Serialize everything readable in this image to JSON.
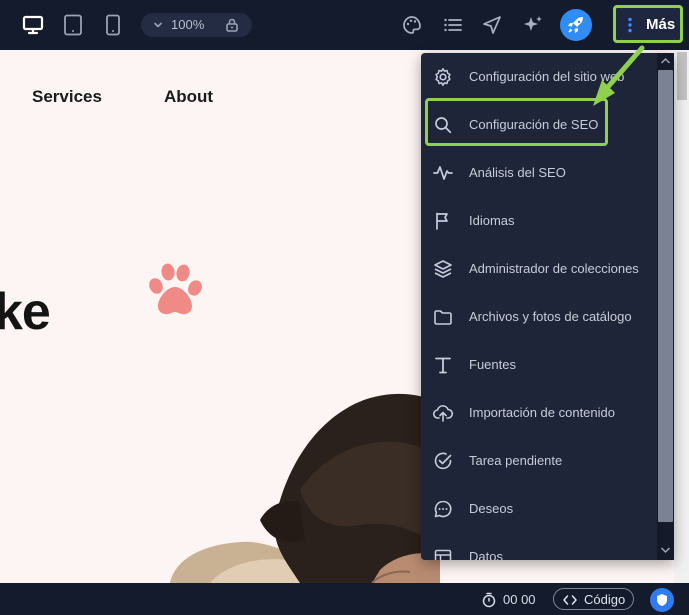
{
  "toolbar": {
    "devices": [
      "desktop-icon",
      "tablet-icon",
      "mobile-icon"
    ],
    "zoom_value": "100%",
    "more_label": "Más",
    "right_icons": [
      "palette-icon",
      "list-icon",
      "navigate-icon",
      "sparkle-icon",
      "rocket-icon"
    ]
  },
  "canvas": {
    "nav": [
      "Services",
      "About"
    ],
    "hero_text": "ke"
  },
  "menu": {
    "items": [
      {
        "label": "Configuración del sitio web",
        "icon": "gear-icon"
      },
      {
        "label": "Configuración de SEO",
        "icon": "search-icon"
      },
      {
        "label": "Análisis del SEO",
        "icon": "pulse-icon"
      },
      {
        "label": "Idiomas",
        "icon": "flag-icon"
      },
      {
        "label": "Administrador de colecciones",
        "icon": "layers-icon"
      },
      {
        "label": "Archivos y fotos de catálogo",
        "icon": "folder-icon"
      },
      {
        "label": "Fuentes",
        "icon": "text-icon"
      },
      {
        "label": "Importación de contenido",
        "icon": "cloud-upload-icon"
      },
      {
        "label": "Tarea pendiente",
        "icon": "check-circle-icon"
      },
      {
        "label": "Deseos",
        "icon": "chat-icon"
      },
      {
        "label": "Datos",
        "icon": "table-icon"
      }
    ]
  },
  "bottombar": {
    "timer": "00 00",
    "code_label": "Código"
  },
  "colors": {
    "topbar": "#141b2d",
    "menu_bg": "#1e2538",
    "highlight": "#8fd14f",
    "accent": "#2f8df5",
    "paw": "#f08a86"
  }
}
